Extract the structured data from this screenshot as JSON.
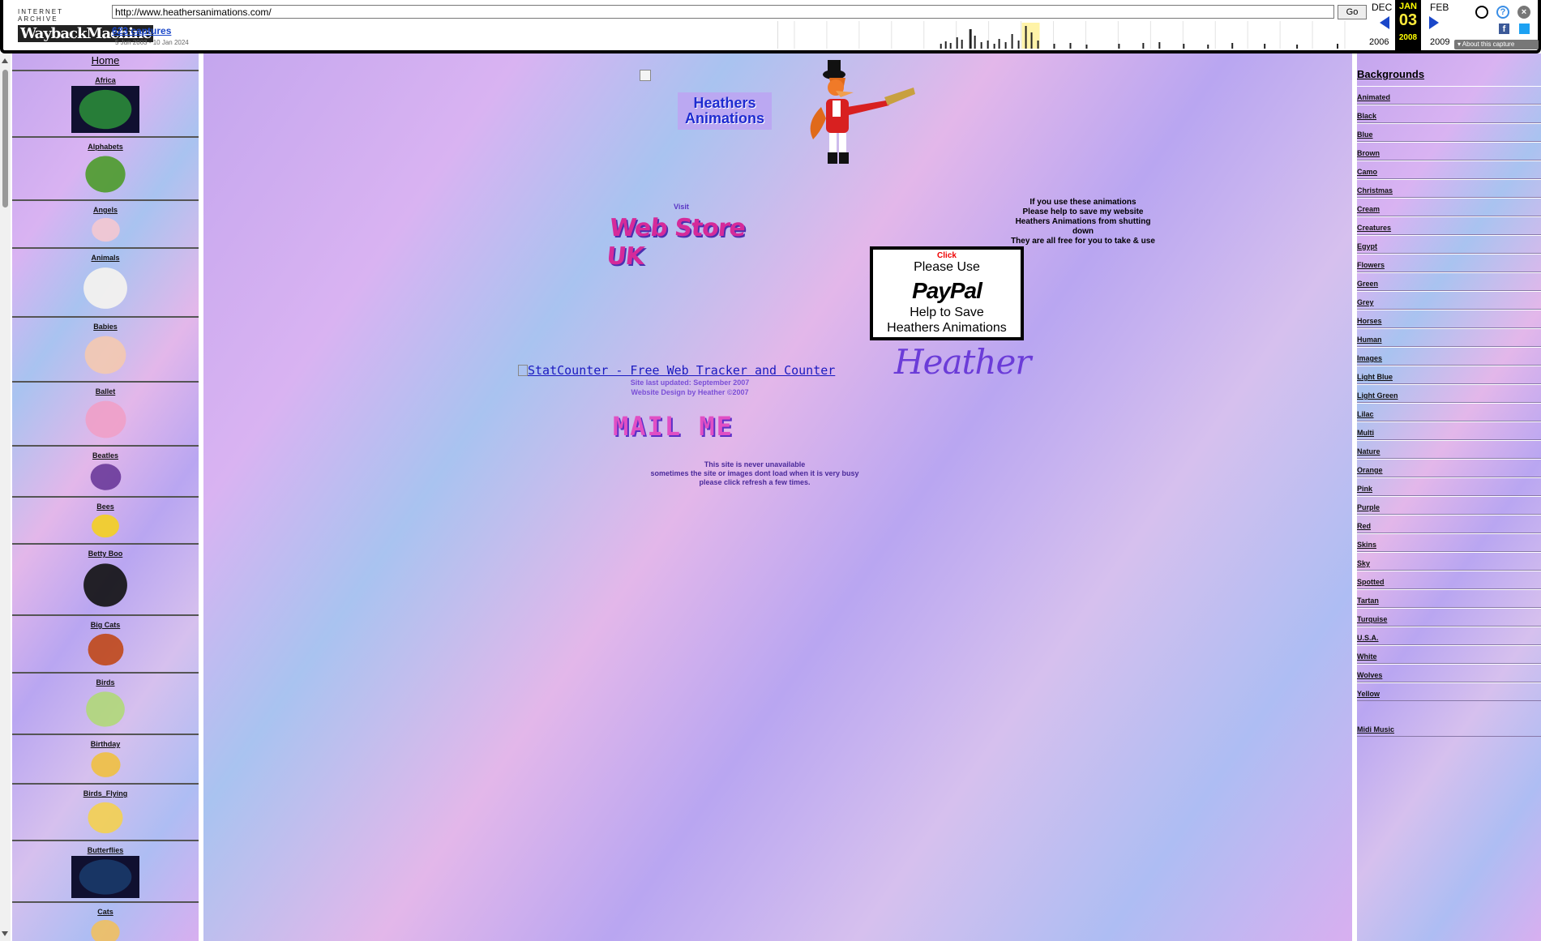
{
  "wayback": {
    "logo_top": "INTERNET ARCHIVE",
    "logo_main": "WaybackMachine",
    "url": "http://www.heathersanimations.com/",
    "go_label": "Go",
    "captures": "623 captures",
    "range": "5 Jun 2003 - 10 Jan 2024",
    "prev_month": "DEC",
    "cur_month": "JAN",
    "cur_day": "03",
    "cur_year": "2008",
    "next_month": "FEB",
    "prev_year": "2006",
    "next_year": "2009",
    "about": "About this capture",
    "icons": [
      "user-icon",
      "help-icon",
      "close-icon",
      "facebook-icon",
      "twitter-icon"
    ]
  },
  "left": {
    "home": "Home",
    "categories": [
      {
        "label": "Africa",
        "h": 82
      },
      {
        "label": "Alphabets",
        "h": 78
      },
      {
        "label": "Angels",
        "h": 59
      },
      {
        "label": "Animals",
        "h": 85
      },
      {
        "label": "Babies",
        "h": 80
      },
      {
        "label": "Ballet",
        "h": 79
      },
      {
        "label": "Beatles",
        "h": 63
      },
      {
        "label": "Bees",
        "h": 58
      },
      {
        "label": "Betty Boo",
        "h": 88
      },
      {
        "label": "Big Cats",
        "h": 71
      },
      {
        "label": "Birds",
        "h": 76
      },
      {
        "label": "Birthday",
        "h": 61
      },
      {
        "label": "Birds_Flying",
        "h": 70
      },
      {
        "label": "Butterflies",
        "h": 76
      },
      {
        "label": "Cats",
        "h": 60
      }
    ]
  },
  "main": {
    "title_line1": "Heathers",
    "title_line2": "Animations",
    "visit": "Visit",
    "webstore": "Web Store UK",
    "help_lines": [
      "If you use these animations",
      "Please help to save my website",
      "Heathers Animations from shutting",
      "down",
      "They are all free for you to take & use"
    ],
    "paypal_click": "Click",
    "paypal_please": "Please Use",
    "paypal_logo": "PayPal",
    "paypal_help": "Help to Save",
    "paypal_ha": "Heathers Animations",
    "statcounter": "StatCounter - Free Web Tracker and Counter",
    "signature": "Heather",
    "updated": "Site last updated: September 2007",
    "design": "Website Design by Heather   ©2007",
    "mailme": "MAIL ME",
    "note1": "This site is never unavailable",
    "note2": "sometimes the site or images dont load when it is very busy",
    "note3": "please click refresh a few times."
  },
  "right": {
    "heading": "Backgrounds",
    "links": [
      "Animated",
      "Black",
      "Blue",
      "Brown",
      "Camo",
      "Christmas",
      "Cream",
      "Creatures",
      "Egypt",
      "Flowers",
      "Green",
      "Grey",
      "Horses",
      "Human",
      "Images",
      "Light Blue",
      "Light Green",
      "Lilac",
      "Multi",
      "Nature",
      "Orange",
      "Pink",
      "Purple",
      "Red",
      "Skins",
      "Sky",
      "Spotted",
      "Tartan",
      "Turquise",
      "U.S.A.",
      "White",
      "Wolves",
      "Yellow"
    ],
    "midi": "Midi Music"
  }
}
